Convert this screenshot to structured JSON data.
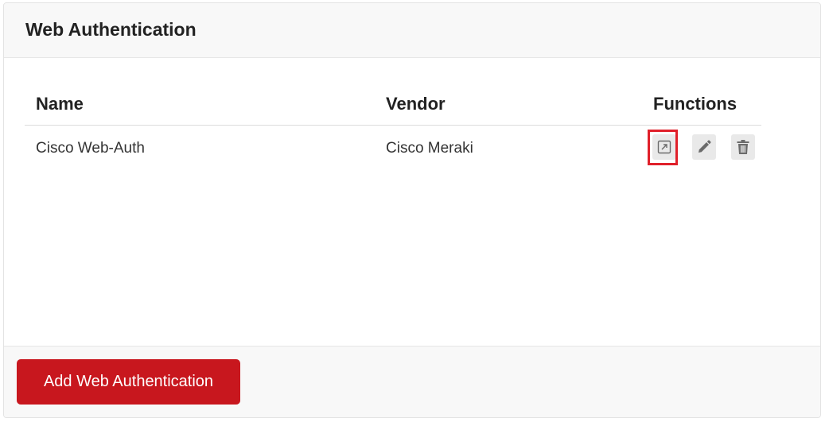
{
  "panel": {
    "title": "Web Authentication"
  },
  "table": {
    "columns": [
      "Name",
      "Vendor",
      "Functions"
    ],
    "rows": [
      {
        "name": "Cisco Web-Auth",
        "vendor": "Cisco Meraki",
        "functions": [
          "open-external-icon",
          "pencil-icon",
          "trash-icon"
        ]
      }
    ]
  },
  "footer": {
    "add_label": "Add Web Authentication"
  },
  "colors": {
    "accent": "#c8171e",
    "highlight": "#e0202a",
    "icon_button_bg": "#e9e9e9",
    "icon": "#6b6b6b"
  }
}
